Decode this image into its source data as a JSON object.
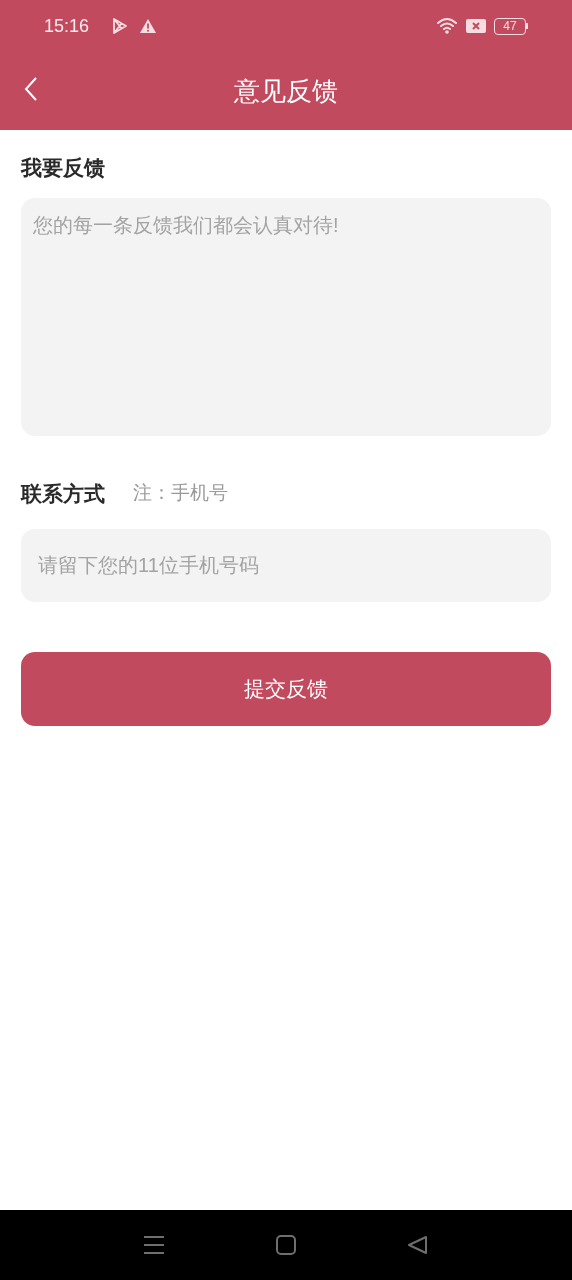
{
  "status_bar": {
    "time": "15:16",
    "battery": "47"
  },
  "header": {
    "title": "意见反馈"
  },
  "feedback": {
    "label": "我要反馈",
    "placeholder": "您的每一条反馈我们都会认真对待!"
  },
  "contact": {
    "label": "联系方式",
    "note": "注：手机号",
    "placeholder": "请留下您的11位手机号码"
  },
  "submit_button": "提交反馈"
}
